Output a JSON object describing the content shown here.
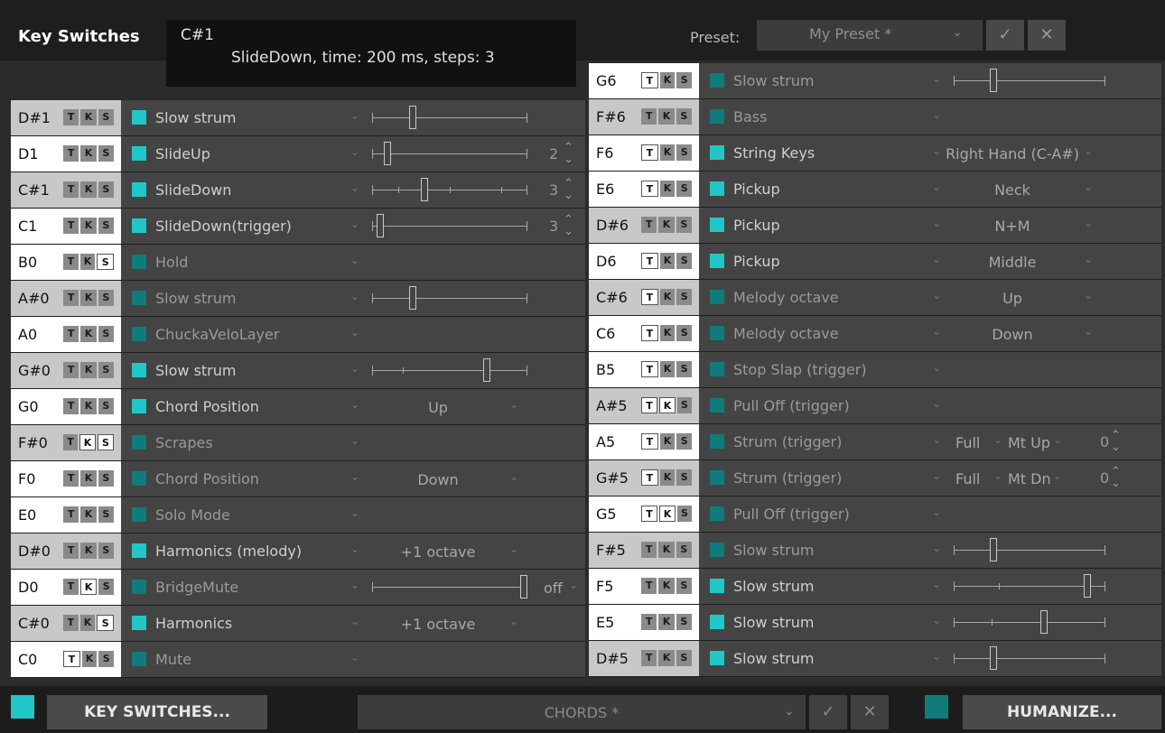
{
  "header": {
    "title": "Key Switches",
    "info_key": "C#1",
    "info_desc": "SlideDown, time: 200 ms, steps: 3",
    "preset_label": "Preset:",
    "preset_value": "My Preset *",
    "confirm_icon": "✓",
    "cancel_icon": "✕",
    "chevron_icon": "⌄"
  },
  "tks": {
    "t": "T",
    "k": "K",
    "s": "S"
  },
  "left_rows": [
    {
      "note": "D#1",
      "shade": "light",
      "t": false,
      "k": false,
      "s": false,
      "checked": true,
      "label": "Slow strum",
      "slider": {
        "value": 0.25,
        "ticks": []
      }
    },
    {
      "note": "D1",
      "shade": "white",
      "t": false,
      "k": false,
      "s": false,
      "checked": true,
      "label": "SlideUp",
      "slider": {
        "value": 0.08,
        "ticks": []
      },
      "value": "2"
    },
    {
      "note": "C#1",
      "shade": "light",
      "t": false,
      "k": false,
      "s": false,
      "checked": true,
      "label": "SlideDown",
      "slider": {
        "value": 0.33,
        "ticks": [
          0.17,
          0.5,
          0.83
        ]
      },
      "value": "3"
    },
    {
      "note": "C1",
      "shade": "white",
      "t": false,
      "k": false,
      "s": false,
      "checked": true,
      "label": "SlideDown(trigger)",
      "slider": {
        "value": 0.03,
        "ticks": []
      },
      "value": "3"
    },
    {
      "note": "B0",
      "shade": "white",
      "t": false,
      "k": false,
      "s": true,
      "checked": false,
      "label": "Hold"
    },
    {
      "note": "A#0",
      "shade": "light",
      "t": false,
      "k": false,
      "s": false,
      "checked": false,
      "label": "Slow strum",
      "slider": {
        "value": 0.25,
        "ticks": []
      }
    },
    {
      "note": "A0",
      "shade": "white",
      "t": false,
      "k": false,
      "s": false,
      "checked": false,
      "label": "ChuckaVeloLayer"
    },
    {
      "note": "G#0",
      "shade": "light",
      "t": false,
      "k": false,
      "s": false,
      "checked": true,
      "label": "Slow strum",
      "slider": {
        "value": 0.75,
        "ticks": [
          0.2
        ]
      }
    },
    {
      "note": "G0",
      "shade": "white",
      "t": false,
      "k": false,
      "s": false,
      "checked": true,
      "label": "Chord Position",
      "option": "Up"
    },
    {
      "note": "F#0",
      "shade": "light",
      "t": false,
      "k": true,
      "s": true,
      "checked": false,
      "label": "Scrapes"
    },
    {
      "note": "F0",
      "shade": "white",
      "t": false,
      "k": false,
      "s": false,
      "checked": false,
      "label": "Chord Position",
      "option": "Down"
    },
    {
      "note": "E0",
      "shade": "white",
      "t": false,
      "k": false,
      "s": false,
      "checked": false,
      "label": "Solo Mode"
    },
    {
      "note": "D#0",
      "shade": "light",
      "t": false,
      "k": false,
      "s": false,
      "checked": true,
      "label": "Harmonics (melody)",
      "option": "+1 octave"
    },
    {
      "note": "D0",
      "shade": "white",
      "t": false,
      "k": true,
      "s": false,
      "checked": false,
      "label": "BridgeMute",
      "slider": {
        "value": 1.0,
        "ticks": []
      },
      "option_small": "off"
    },
    {
      "note": "C#0",
      "shade": "light",
      "t": false,
      "k": false,
      "s": true,
      "checked": true,
      "label": "Harmonics",
      "option": "+1 octave"
    },
    {
      "note": "C0",
      "shade": "white",
      "t": true,
      "k": false,
      "s": false,
      "checked": false,
      "label": "Mute"
    }
  ],
  "right_rows": [
    {
      "note": "G6",
      "shade": "white",
      "t": true,
      "k": false,
      "s": false,
      "checked": false,
      "label": "Slow strum",
      "slider": {
        "value": 0.25,
        "ticks": []
      }
    },
    {
      "note": "F#6",
      "shade": "light",
      "t": false,
      "k": false,
      "s": false,
      "checked": false,
      "label": "Bass"
    },
    {
      "note": "F6",
      "shade": "white",
      "t": true,
      "k": false,
      "s": false,
      "checked": true,
      "label": "String Keys",
      "option": "Right Hand (C-A#)"
    },
    {
      "note": "E6",
      "shade": "white",
      "t": true,
      "k": false,
      "s": false,
      "checked": true,
      "label": "Pickup",
      "option": "Neck"
    },
    {
      "note": "D#6",
      "shade": "light",
      "t": false,
      "k": false,
      "s": false,
      "checked": true,
      "label": "Pickup",
      "option": "N+M"
    },
    {
      "note": "D6",
      "shade": "white",
      "t": true,
      "k": false,
      "s": false,
      "checked": true,
      "label": "Pickup",
      "option": "Middle"
    },
    {
      "note": "C#6",
      "shade": "light",
      "t": true,
      "k": false,
      "s": false,
      "checked": false,
      "label": "Melody octave",
      "option": "Up"
    },
    {
      "note": "C6",
      "shade": "white",
      "t": true,
      "k": false,
      "s": false,
      "checked": false,
      "label": "Melody octave",
      "option": "Down"
    },
    {
      "note": "B5",
      "shade": "white",
      "t": true,
      "k": false,
      "s": false,
      "checked": false,
      "label": "Stop Slap (trigger)"
    },
    {
      "note": "A#5",
      "shade": "light",
      "t": true,
      "k": true,
      "s": false,
      "checked": false,
      "label": "Pull Off (trigger)"
    },
    {
      "note": "A5",
      "shade": "white",
      "t": true,
      "k": false,
      "s": false,
      "checked": false,
      "label": "Strum (trigger)",
      "strum": {
        "full": "Full",
        "mt": "Mt Up",
        "val": "0"
      }
    },
    {
      "note": "G#5",
      "shade": "light",
      "t": true,
      "k": false,
      "s": false,
      "checked": false,
      "label": "Strum (trigger)",
      "strum": {
        "full": "Full",
        "mt": "Mt Dn",
        "val": "0"
      }
    },
    {
      "note": "G5",
      "shade": "white",
      "t": true,
      "k": true,
      "s": false,
      "checked": false,
      "label": "Pull Off (trigger)"
    },
    {
      "note": "F#5",
      "shade": "light",
      "t": false,
      "k": false,
      "s": false,
      "checked": false,
      "label": "Slow strum",
      "slider": {
        "value": 0.25,
        "ticks": []
      }
    },
    {
      "note": "F5",
      "shade": "white",
      "t": false,
      "k": false,
      "s": false,
      "checked": true,
      "label": "Slow strum",
      "slider": {
        "value": 0.9,
        "ticks": [
          0.3
        ]
      }
    },
    {
      "note": "E5",
      "shade": "white",
      "t": false,
      "k": false,
      "s": false,
      "checked": true,
      "label": "Slow strum",
      "slider": {
        "value": 0.6,
        "ticks": [
          0.25
        ]
      }
    },
    {
      "note": "D#5",
      "shade": "light",
      "t": false,
      "k": false,
      "s": false,
      "checked": true,
      "label": "Slow strum",
      "slider": {
        "value": 0.25,
        "ticks": []
      }
    }
  ],
  "footer": {
    "key_switches_label": "KEY SWITCHES...",
    "chords_label": "CHORDS *",
    "humanize_label": "HUMANIZE...",
    "confirm_icon": "✓",
    "cancel_icon": "✕",
    "chevron_icon": "⌄"
  },
  "spin_icons": {
    "up": "⌃",
    "down": "⌄"
  }
}
